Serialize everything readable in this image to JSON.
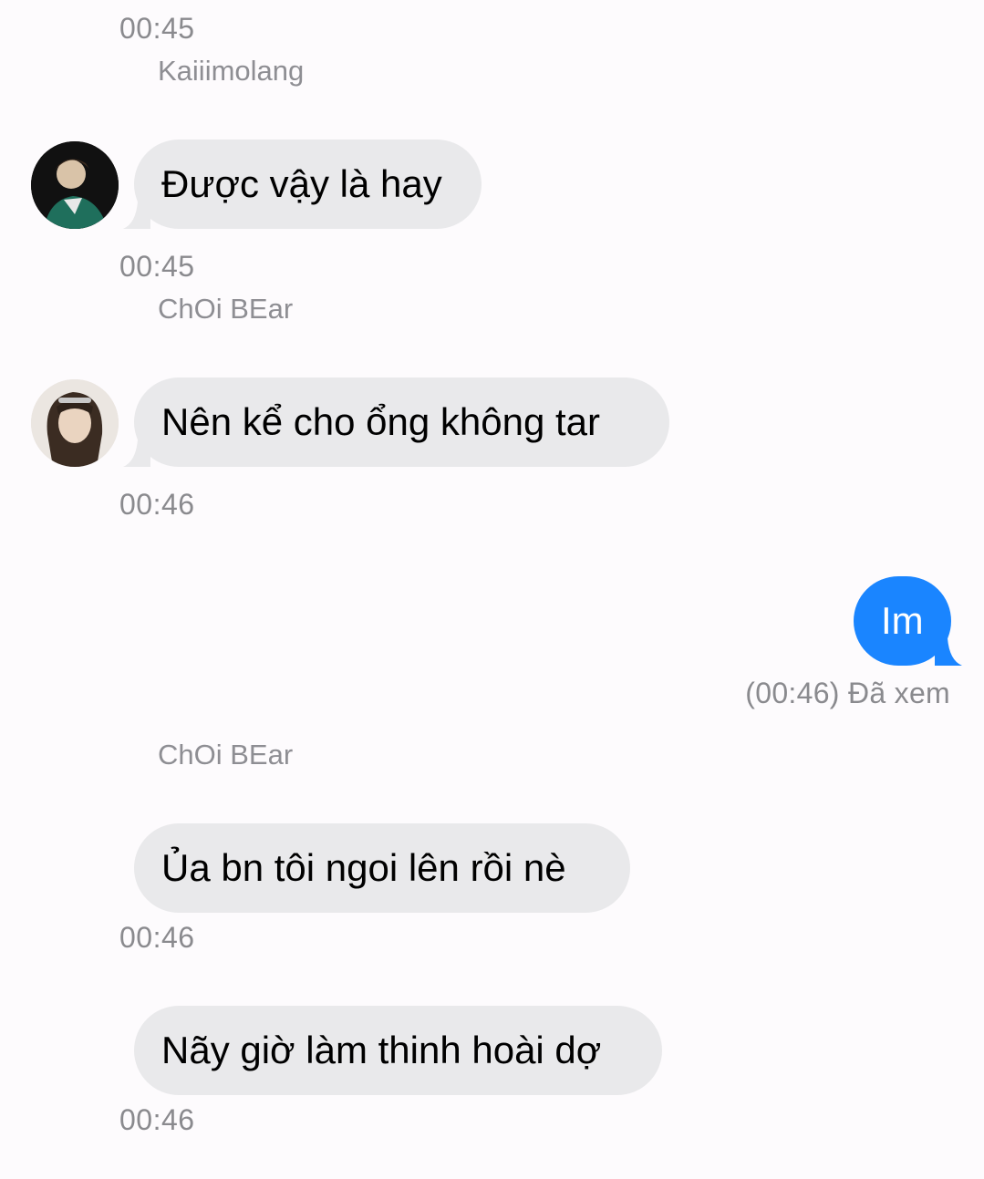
{
  "messages": [
    {
      "time": "00:45",
      "sender": "Kaiiimolang"
    },
    {
      "text": "Được vậy là hay",
      "avatar": "avatar-kaiiimolang",
      "time": "00:45",
      "sender": "ChOi BEar"
    },
    {
      "text": "Nên kể cho ổng không tar",
      "avatar": "avatar-choi-bear",
      "time": "00:46"
    },
    {
      "text": "Im",
      "outgoing": true,
      "status": "(00:46) Đã xem"
    },
    {
      "sender": "ChOi BEar"
    },
    {
      "text": "Ủa bn tôi ngoi lên rồi nè",
      "time": "00:46"
    },
    {
      "text": "Nãy giờ làm thinh hoài dợ",
      "time": "00:46"
    }
  ],
  "colors": {
    "incoming_bubble": "#e9e9eb",
    "outgoing_bubble": "#1a85ff",
    "meta_text": "#8a8a8e",
    "background": "#fdfbfd"
  }
}
